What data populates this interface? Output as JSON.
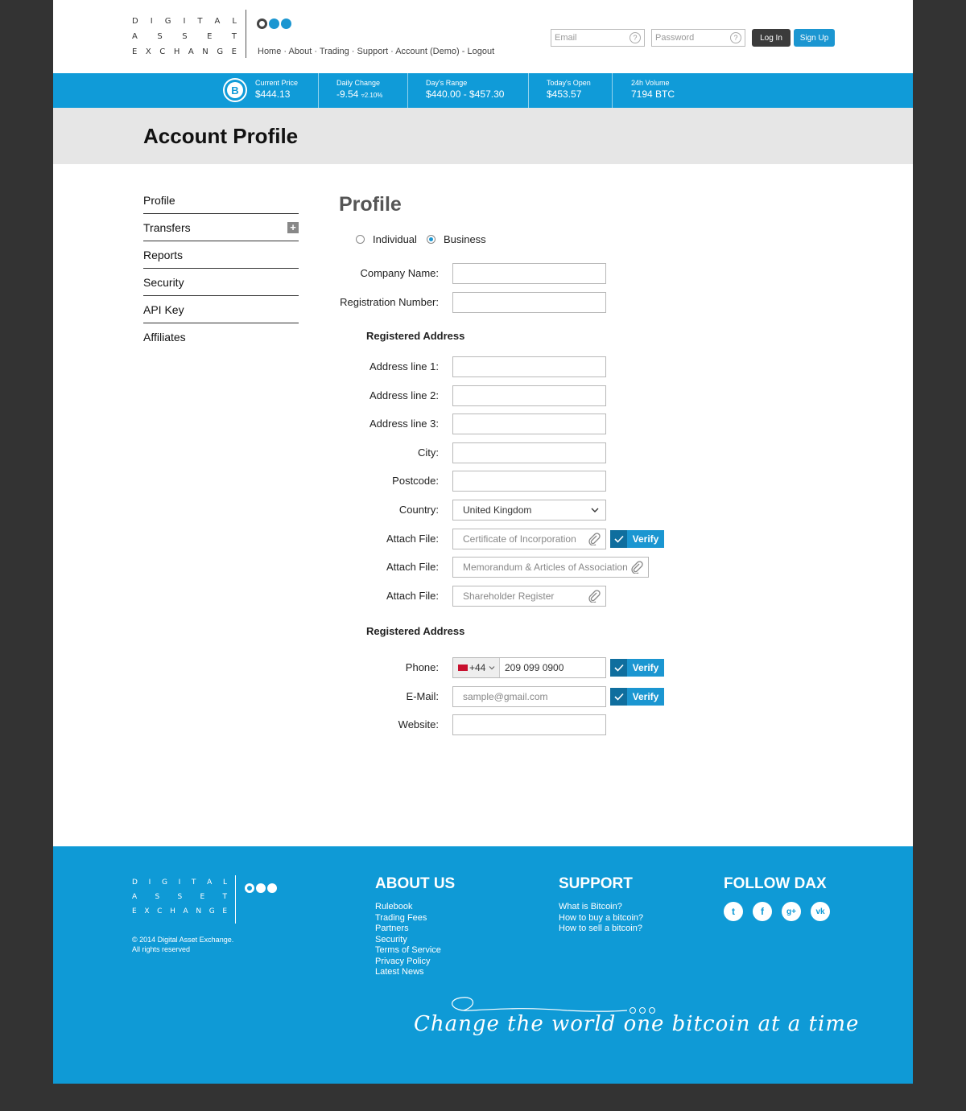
{
  "logo": {
    "lines": [
      [
        "D",
        "I",
        "G",
        "I",
        "T",
        "A",
        "L"
      ],
      [
        "A",
        "S",
        "S",
        "E",
        "T"
      ],
      [
        "E",
        "X",
        "C",
        "H",
        "A",
        "N",
        "G",
        "E"
      ]
    ]
  },
  "nav": {
    "items": [
      "Home",
      "About",
      "Trading",
      "Support",
      "Account (Demo)",
      "Logout"
    ]
  },
  "login": {
    "email_placeholder": "Email",
    "password_placeholder": "Password",
    "help_glyph": "?",
    "login_label": "Log In",
    "signup_label": "Sign Up"
  },
  "ticker": {
    "btc_glyph": "B",
    "current_price": {
      "label": "Current Price",
      "value": "$444.13"
    },
    "daily_change": {
      "label": "Daily Change",
      "value": "-9.54",
      "pct": "2.10%"
    },
    "days_range": {
      "label": "Day's Range",
      "value": "$440.00 - $457.30"
    },
    "todays_open": {
      "label": "Today's Open",
      "value": "$453.57"
    },
    "volume": {
      "label": "24h Volume",
      "value": "7194 BTC"
    }
  },
  "page": {
    "title": "Account Profile"
  },
  "sidebar": {
    "items": [
      {
        "label": "Profile"
      },
      {
        "label": "Transfers",
        "expand": "+"
      },
      {
        "label": "Reports"
      },
      {
        "label": "Security"
      },
      {
        "label": "API Key"
      },
      {
        "label": "Affiliates"
      }
    ]
  },
  "form": {
    "heading": "Profile",
    "type_options": [
      "Individual",
      "Business"
    ],
    "type_selected": "Business",
    "company_name": {
      "label": "Company Name:",
      "value": ""
    },
    "registration_number": {
      "label": "Registration Number:",
      "value": ""
    },
    "address_heading": "Registered Address",
    "address_line1": {
      "label": "Address line 1:",
      "value": ""
    },
    "address_line2": {
      "label": "Address line 2:",
      "value": ""
    },
    "address_line3": {
      "label": "Address line 3:",
      "value": ""
    },
    "city": {
      "label": "City:",
      "value": ""
    },
    "postcode": {
      "label": "Postcode:",
      "value": ""
    },
    "country": {
      "label": "Country:",
      "value": "United Kingdom"
    },
    "attach1": {
      "label": "Attach File:",
      "placeholder": "Certificate of Incorporation"
    },
    "attach2": {
      "label": "Attach File:",
      "placeholder": "Memorandum & Articles of Association"
    },
    "attach3": {
      "label": "Attach File:",
      "placeholder": "Shareholder Register"
    },
    "contact_heading": "Registered Address",
    "phone": {
      "label": "Phone:",
      "country_code": "+44",
      "value": "209 099 0900"
    },
    "email": {
      "label": "E-Mail:",
      "placeholder": "sample@gmail.com"
    },
    "website": {
      "label": "Website:",
      "value": ""
    },
    "verify_label": "Verify"
  },
  "footer": {
    "copyright_line1": "© 2014 Digital Asset Exchange.",
    "copyright_line2": "All rights reserved",
    "about": {
      "title": "ABOUT US",
      "links": [
        "Rulebook",
        "Trading Fees",
        "Partners",
        "Security",
        "Terms of Service",
        "Privacy Policy",
        "Latest News"
      ]
    },
    "support": {
      "title": "SUPPORT",
      "links": [
        "What is Bitcoin?",
        "How to buy a bitcoin?",
        "How to sell a bitcoin?"
      ]
    },
    "follow": {
      "title": "FOLLOW DAX",
      "icons": [
        {
          "name": "twitter-icon",
          "glyph": "t"
        },
        {
          "name": "facebook-icon",
          "glyph": "f"
        },
        {
          "name": "google-plus-icon",
          "glyph": "g+"
        },
        {
          "name": "vk-icon",
          "glyph": "vk"
        }
      ]
    },
    "slogan": "Change the world one bitcoin at a time"
  },
  "colors": {
    "brand_blue": "#1b96d1",
    "ticker_blue": "#109bd8",
    "footer_blue": "#0f9ad6",
    "dark_button": "#3b3b3b",
    "backdrop": "#333333"
  }
}
